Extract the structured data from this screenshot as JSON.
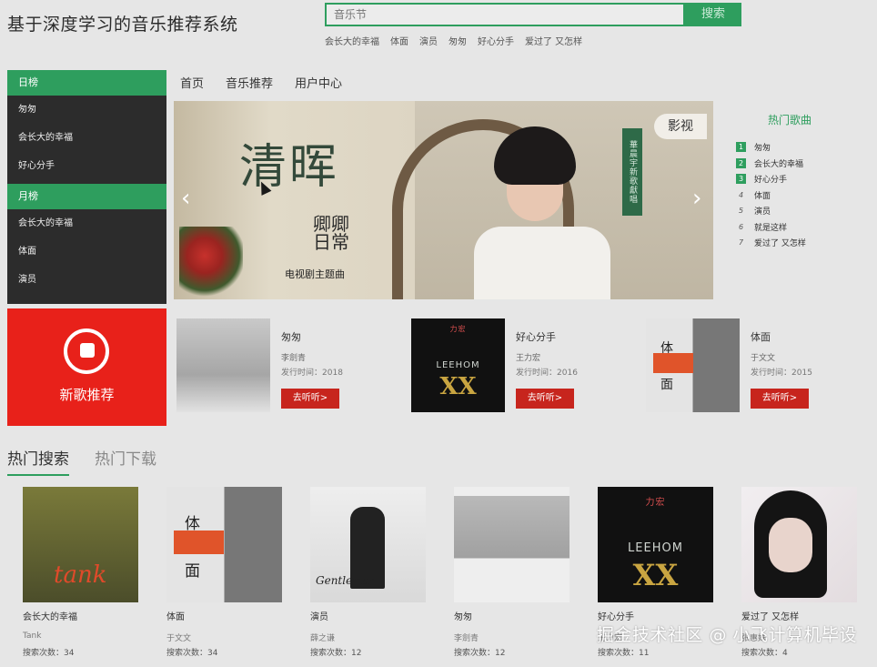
{
  "header": {
    "site_title": "基于深度学习的音乐推荐系统",
    "search_placeholder": "音乐节",
    "search_button": "搜索",
    "hot_keywords": [
      "会长大的幸福",
      "体面",
      "演员",
      "匆匆",
      "好心分手",
      "爱过了 又怎样"
    ]
  },
  "nav": [
    "首页",
    "音乐推荐",
    "用户中心"
  ],
  "sidebar": {
    "daily_label": "日榜",
    "daily_items": [
      "匆匆",
      "会长大的幸福",
      "好心分手"
    ],
    "monthly_label": "月榜",
    "monthly_items": [
      "会长大的幸福",
      "体面",
      "演员"
    ],
    "new_songs_label": "新歌推荐"
  },
  "banner": {
    "title": "清晖",
    "sub_title": "卿卿日常",
    "sub_caption": "电视剧主题曲",
    "tag": "影视",
    "vertical_text": "華晨宇新歌獻唱",
    "prev_arrow": "‹",
    "next_arrow": "›"
  },
  "hot_songs": {
    "title": "热门歌曲",
    "items": [
      {
        "rank": "1",
        "name": "匆匆"
      },
      {
        "rank": "2",
        "name": "会长大的幸福"
      },
      {
        "rank": "3",
        "name": "好心分手"
      },
      {
        "rank": "4",
        "name": "体面"
      },
      {
        "rank": "5",
        "name": "演员"
      },
      {
        "rank": "6",
        "name": "就是这样"
      },
      {
        "rank": "7",
        "name": "爱过了 又怎样"
      }
    ]
  },
  "albums": [
    {
      "title": "匆匆",
      "artist": "李劍青",
      "date_label": "发行时间：",
      "date": "2018",
      "button": "去听听>"
    },
    {
      "title": "好心分手",
      "artist": "王力宏",
      "date_label": "发行时间：",
      "date": "2016",
      "button": "去听听>"
    },
    {
      "title": "体面",
      "artist": "于文文",
      "date_label": "发行时间：",
      "date": "2015",
      "button": "去听听>"
    }
  ],
  "tabs": [
    "热门搜索",
    "热门下载"
  ],
  "hot_search": {
    "count_label": "搜索次数：",
    "items": [
      {
        "title": "会长大的幸福",
        "artist": "Tank",
        "count": "34"
      },
      {
        "title": "体面",
        "artist": "于文文",
        "count": "34"
      },
      {
        "title": "演员",
        "artist": "薛之谦",
        "count": "12"
      },
      {
        "title": "匆匆",
        "artist": "李劍青",
        "count": "12"
      },
      {
        "title": "好心分手",
        "artist": "王力宏",
        "count": "11"
      },
      {
        "title": "爱过了 又怎样",
        "artist": "张惠妹",
        "count": "4"
      }
    ]
  },
  "cover_text": {
    "leehom_brand": "力宏",
    "leehom_name": "LEEHOM",
    "leehom_xx": "XX",
    "tank_script": "tank",
    "yu_char1": "体",
    "yu_char2": "面",
    "xue_script": "Gentleman"
  },
  "watermark": "掘金技术社区 @ 小飞计算机毕设",
  "colors": {
    "accent": "#2e9e5e",
    "red": "#e8211a",
    "button_red": "#c7251d",
    "sidebar_bg": "#2c2c2c"
  }
}
